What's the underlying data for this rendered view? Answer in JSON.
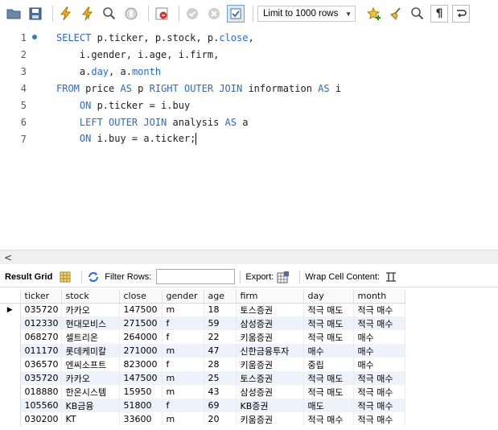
{
  "toolbar": {
    "limit_label": "Limit to 1000 rows"
  },
  "editor": {
    "lines": [
      {
        "num": "1",
        "tokens": [
          {
            "t": "SELECT",
            "k": true
          },
          {
            "t": " p.ticker, p.stock, p.",
            "k": false
          },
          {
            "t": "close",
            "k": true
          },
          {
            "t": ",",
            "k": false
          }
        ]
      },
      {
        "num": "2",
        "tokens": [
          {
            "t": "    i.gender, i.age, i.firm,",
            "k": false
          }
        ]
      },
      {
        "num": "3",
        "tokens": [
          {
            "t": "    a.",
            "k": false
          },
          {
            "t": "day",
            "k": true
          },
          {
            "t": ", a.",
            "k": false
          },
          {
            "t": "month",
            "k": true
          }
        ]
      },
      {
        "num": "4",
        "tokens": [
          {
            "t": "FROM",
            "k": true
          },
          {
            "t": " price ",
            "k": false
          },
          {
            "t": "AS",
            "k": true
          },
          {
            "t": " p ",
            "k": false
          },
          {
            "t": "RIGHT OUTER JOIN",
            "k": true
          },
          {
            "t": " information ",
            "k": false
          },
          {
            "t": "AS",
            "k": true
          },
          {
            "t": " i",
            "k": false
          }
        ]
      },
      {
        "num": "5",
        "tokens": [
          {
            "t": "    ",
            "k": false
          },
          {
            "t": "ON",
            "k": true
          },
          {
            "t": " p.ticker = i.buy",
            "k": false
          }
        ]
      },
      {
        "num": "6",
        "tokens": [
          {
            "t": "    ",
            "k": false
          },
          {
            "t": "LEFT OUTER JOIN",
            "k": true
          },
          {
            "t": " analysis ",
            "k": false
          },
          {
            "t": "AS",
            "k": true
          },
          {
            "t": " a",
            "k": false
          }
        ]
      },
      {
        "num": "7",
        "tokens": [
          {
            "t": "    ",
            "k": false
          },
          {
            "t": "ON",
            "k": true
          },
          {
            "t": " i.buy = a.ticker;",
            "k": false
          }
        ]
      }
    ]
  },
  "result_toolbar": {
    "result_grid_label": "Result Grid",
    "filter_label": "Filter Rows:",
    "export_label": "Export:",
    "wrap_label": "Wrap Cell Content:"
  },
  "grid": {
    "columns": [
      "ticker",
      "stock",
      "close",
      "gender",
      "age",
      "firm",
      "day",
      "month"
    ],
    "rows": [
      [
        "035720",
        "카카오",
        "147500",
        "m",
        "18",
        "토스증권",
        "적극 매도",
        "적극 매수"
      ],
      [
        "012330",
        "현대모비스",
        "271500",
        "f",
        "59",
        "삼성증권",
        "적극 매도",
        "적극 매수"
      ],
      [
        "068270",
        "셀트리온",
        "264000",
        "f",
        "22",
        "키움증권",
        "적극 매도",
        "매수"
      ],
      [
        "011170",
        "롯데케미칼",
        "271000",
        "m",
        "47",
        "신한금융투자",
        "매수",
        "매수"
      ],
      [
        "036570",
        "엔씨소프트",
        "823000",
        "f",
        "28",
        "키움증권",
        "중립",
        "매수"
      ],
      [
        "035720",
        "카카오",
        "147500",
        "m",
        "25",
        "토스증권",
        "적극 매도",
        "적극 매수"
      ],
      [
        "018880",
        "한온시스템",
        "15950",
        "m",
        "43",
        "삼성증권",
        "적극 매도",
        "적극 매수"
      ],
      [
        "105560",
        "KB금융",
        "51800",
        "f",
        "69",
        "KB증권",
        "매도",
        "적극 매수"
      ],
      [
        "030200",
        "KT",
        "33600",
        "m",
        "20",
        "키움증권",
        "적극 매수",
        "적극 매수"
      ]
    ]
  }
}
